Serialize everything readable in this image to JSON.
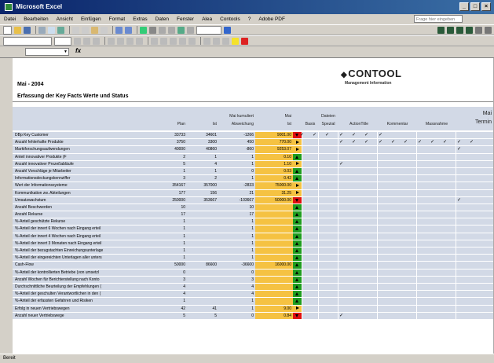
{
  "window": {
    "title": "Microsoft Excel"
  },
  "menu": {
    "items": [
      "Datei",
      "Bearbeiten",
      "Ansicht",
      "Einfügen",
      "Format",
      "Extras",
      "Daten",
      "Fenster",
      "Alea",
      "Contools",
      "?",
      "Adobe PDF"
    ],
    "question_placeholder": "Frage hier eingeben"
  },
  "logo": {
    "name": "CONTOOL",
    "subtitle": "Management Information"
  },
  "sheet": {
    "period": "Mai - 2004",
    "heading": "Erfassung der Key Facts Werte und Status",
    "columns": {
      "plan": "Plan",
      "ist": "Ist",
      "abw_line1": "Mai kumuliert",
      "abw_line2": "Abweichung",
      "mai_line1": "Mai",
      "mai_line2": "Ist",
      "basis": "Basis",
      "dateien_line1": "Dateien",
      "dateien_line2": "Spezial",
      "action": "ActionTitle",
      "kommentar": "Kommentar",
      "massnahme": "Massnahme",
      "termin_line1": "Mai",
      "termin_line2": "Termin"
    },
    "rows": [
      {
        "name": "DBp Key Customer",
        "plan": "33733",
        "ist": "34601",
        "abw": "-1266",
        "mai": "9001.00",
        "status": "red",
        "checks": [
          0,
          1,
          2,
          3,
          4,
          5,
          6
        ]
      },
      {
        "name": "Anzahl fehlerhafte Produkte",
        "plan": "3750",
        "ist": "3300",
        "abw": "450",
        "mai": "770.00",
        "status": "yellow",
        "checks": [
          3,
          4,
          5,
          6,
          7,
          8,
          9,
          10,
          11,
          12,
          13
        ]
      },
      {
        "name": "Marktforschungsaufwendungen",
        "plan": "40000",
        "ist": "40860",
        "abw": "-860",
        "mai": "9253.07",
        "status": "yellow",
        "checks": [
          12
        ]
      },
      {
        "name": "Anteil innovativer Produkte (F",
        "plan": "2",
        "ist": "1",
        "abw": "1",
        "mai": "0.10",
        "status": "green",
        "checks": []
      },
      {
        "name": "Anzahl innovativer Prozeßabläufe",
        "plan": "5",
        "ist": "4",
        "abw": "1",
        "mai": "1.10",
        "status": "yellow",
        "checks": [
          3
        ]
      },
      {
        "name": "Anzahl Vorschläge je Mitarbeiter",
        "plan": "1",
        "ist": "1",
        "abw": "0",
        "mai": "0.03",
        "status": "green",
        "checks": []
      },
      {
        "name": "Informationsdeckungskennziffer",
        "plan": "3",
        "ist": "2",
        "abw": "1",
        "mai": "0.42",
        "status": "green",
        "checks": []
      },
      {
        "name": "Wert der Informationssysteme",
        "plan": "354167",
        "ist": "357000",
        "abw": "-2833",
        "mai": "75000.00",
        "status": "yellow",
        "checks": []
      },
      {
        "name": "Kommunikation zw. Abteilungen",
        "plan": "177",
        "ist": "156",
        "abw": "21",
        "mai": "31.25",
        "status": "yellow",
        "checks": []
      },
      {
        "name": "Umsatzwachstum",
        "plan": "250000",
        "ist": "353667",
        "abw": "-103667",
        "mai": "50000.00",
        "status": "red",
        "checks": [
          12
        ]
      },
      {
        "name": "Anzahl Beschwerden",
        "plan": "10",
        "ist": "",
        "abw": "10",
        "mai": "",
        "status": "green",
        "checks": []
      },
      {
        "name": "Anzahl Rekurse",
        "plan": "17",
        "ist": "",
        "abw": "17",
        "mai": "",
        "status": "green",
        "checks": []
      },
      {
        "name": "%-Anteil geschützte Rekurse",
        "plan": "1",
        "ist": "",
        "abw": "1",
        "mai": "",
        "status": "green",
        "checks": []
      },
      {
        "name": "%-Anteil der innert 6 Wochen nach Eingang erteil",
        "plan": "1",
        "ist": "",
        "abw": "1",
        "mai": "",
        "status": "green",
        "checks": []
      },
      {
        "name": "%-Anteil der innert 4 Wochen nach Eingang erteil",
        "plan": "1",
        "ist": "",
        "abw": "1",
        "mai": "",
        "status": "green",
        "checks": []
      },
      {
        "name": "%-Anteil der innert 3 Monaten nach Eingang erteil",
        "plan": "1",
        "ist": "",
        "abw": "1",
        "mai": "",
        "status": "green",
        "checks": []
      },
      {
        "name": "%-Anteil der bezugstachten Einreichungsunterlage",
        "plan": "1",
        "ist": "",
        "abw": "1",
        "mai": "",
        "status": "green",
        "checks": []
      },
      {
        "name": "%-Anteil der eingereichten Unterlagen aller unters",
        "plan": "1",
        "ist": "",
        "abw": "1",
        "mai": "",
        "status": "green",
        "checks": []
      },
      {
        "name": "Cash-Flow",
        "plan": "50000",
        "ist": "86600",
        "abw": "-36600",
        "mai": "16000.00",
        "status": "green",
        "checks": []
      },
      {
        "name": "%-Anteil der kontrollierten Betriebe (von umsetzl",
        "plan": "0",
        "ist": "",
        "abw": "0",
        "mai": "",
        "status": "green",
        "checks": []
      },
      {
        "name": "Anzahl Wochen für Berichterstellung nach Konto",
        "plan": "3",
        "ist": "",
        "abw": "3",
        "mai": "",
        "status": "green",
        "checks": []
      },
      {
        "name": "Durchschnittliche Beurteilung der Empfehlungen (",
        "plan": "4",
        "ist": "",
        "abw": "4",
        "mai": "",
        "status": "green",
        "checks": []
      },
      {
        "name": "%-Anteil der geschulten Verantwortlichen in den (",
        "plan": "4",
        "ist": "",
        "abw": "4",
        "mai": "",
        "status": "green",
        "checks": []
      },
      {
        "name": "%-Anteil der erfassten Gefahren und Risiken",
        "plan": "1",
        "ist": "",
        "abw": "1",
        "mai": "",
        "status": "green",
        "checks": []
      },
      {
        "name": "Erfolg in neuen Vertriebswegen",
        "plan": "42",
        "ist": "41",
        "abw": "1",
        "mai": "9.00",
        "status": "yellow",
        "checks": []
      },
      {
        "name": "Anzahl neuer Vertriebswege",
        "plan": "5",
        "ist": "5",
        "abw": "0",
        "mai": "0.84",
        "status": "red",
        "checks": [
          3
        ]
      }
    ]
  },
  "statusbar": {
    "text": "Bereit"
  }
}
